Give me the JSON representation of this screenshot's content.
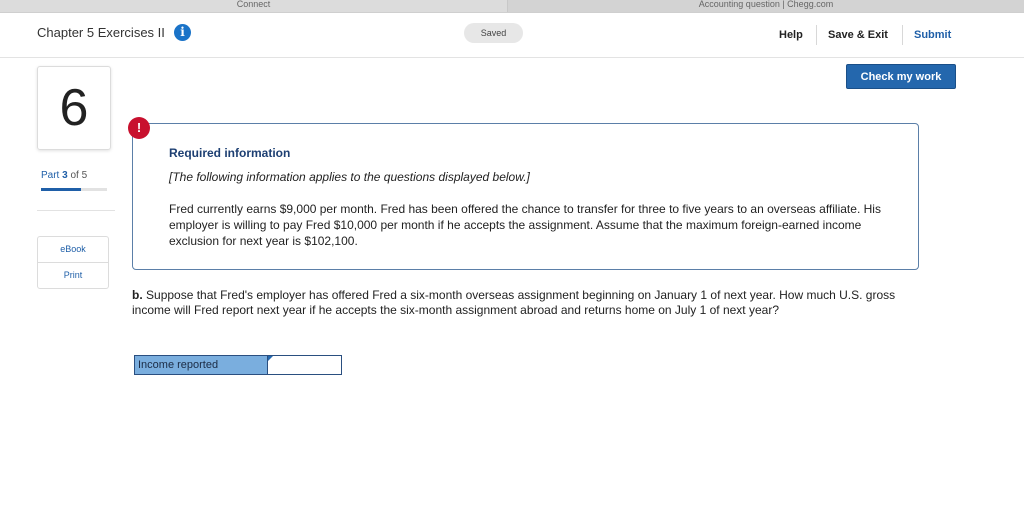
{
  "browser": {
    "tabs": [
      "Connect",
      "Accounting question | Chegg.com"
    ]
  },
  "header": {
    "chapter_title": "Chapter 5 Exercises II",
    "info_icon": "info-icon",
    "status": "Saved",
    "help": "Help",
    "save_exit": "Save & Exit",
    "submit": "Submit"
  },
  "actions": {
    "check_my_work": "Check my work"
  },
  "question_nav": {
    "number": "6",
    "part_word": "Part",
    "part_current": "3",
    "part_of": "of 5",
    "progress_fraction": 0.6,
    "ebook": "eBook",
    "print": "Print"
  },
  "required_info": {
    "alert_icon": "!",
    "title": "Required information",
    "note": "[The following information applies to the questions displayed below.]",
    "body": "Fred currently earns $9,000 per month. Fred has been offered the chance to transfer for three to five years to an overseas affiliate. His employer is willing to pay Fred $10,000 per month if he accepts the assignment. Assume that the maximum foreign-earned income exclusion for next year is $102,100."
  },
  "question": {
    "label": "b.",
    "text": "Suppose that Fred's employer has offered Fred a six-month overseas assignment beginning on January 1 of next year. How much U.S. gross income will Fred report next year if he accepts the six-month assignment abroad and returns home on July 1 of next year?"
  },
  "answer": {
    "label": "Income reported",
    "value": ""
  },
  "colors": {
    "brand_blue": "#2467ad",
    "alert_red": "#c8102e",
    "answer_label_bg": "#7aaede"
  }
}
